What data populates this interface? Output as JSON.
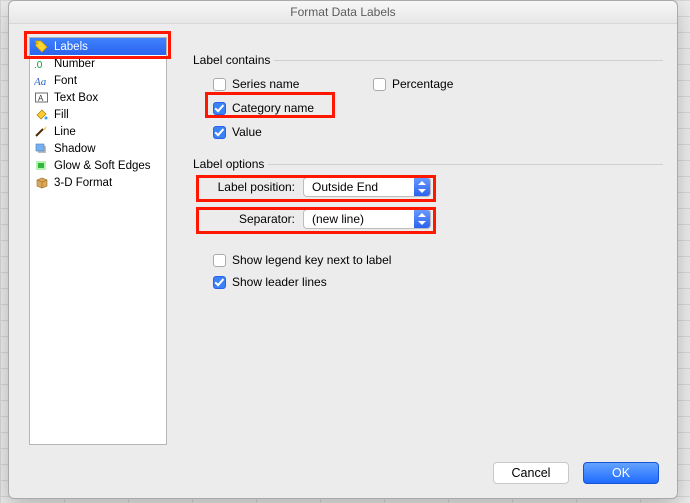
{
  "window": {
    "title": "Format Data Labels"
  },
  "sidebar": {
    "items": [
      {
        "label": "Labels"
      },
      {
        "label": "Number"
      },
      {
        "label": "Font"
      },
      {
        "label": "Text Box"
      },
      {
        "label": "Fill"
      },
      {
        "label": "Line"
      },
      {
        "label": "Shadow"
      },
      {
        "label": "Glow & Soft Edges"
      },
      {
        "label": "3-D Format"
      }
    ]
  },
  "labels": {
    "contains_heading": "Label contains",
    "options_heading": "Label options",
    "series_name": "Series name",
    "percentage": "Percentage",
    "category_name": "Category name",
    "value": "Value",
    "label_position": "Label position:",
    "label_position_value": "Outside End",
    "separator": "Separator:",
    "separator_value": "(new line)",
    "show_legend_key": "Show legend key next to label",
    "show_leader_lines": "Show leader lines"
  },
  "footer": {
    "cancel": "Cancel",
    "ok": "OK"
  }
}
